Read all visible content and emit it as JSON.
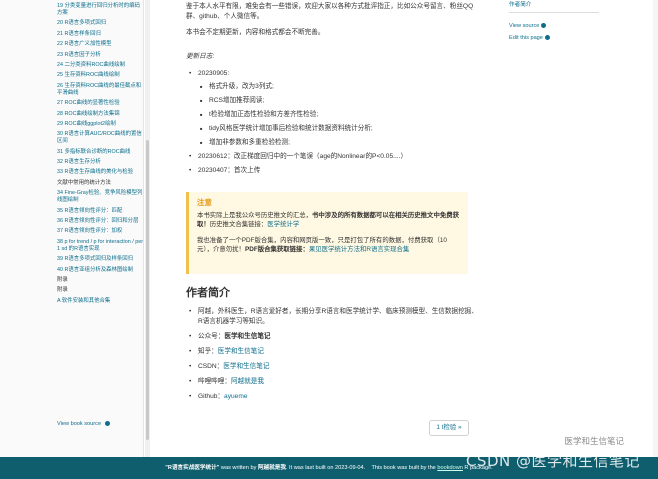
{
  "sidebar": {
    "items": [
      {
        "label": "19 分类变量进行回归分析时的编码方案",
        "kind": "link"
      },
      {
        "label": "20 R语言多项式回归",
        "kind": "link"
      },
      {
        "label": "21 R语言样条回归",
        "kind": "link"
      },
      {
        "label": "22 R语言广义加性模型",
        "kind": "link"
      },
      {
        "label": "23 R语言因子分析",
        "kind": "link"
      },
      {
        "label": "24 二分类资料ROC曲线绘制",
        "kind": "link"
      },
      {
        "label": "25 生存资料ROC曲线绘制",
        "kind": "link"
      },
      {
        "label": "26 生存资料ROC曲线的最佳截点和平滑曲线",
        "kind": "link"
      },
      {
        "label": "27 ROC曲线的显著性检验",
        "kind": "link"
      },
      {
        "label": "28 ROC曲线绘制方法集锦",
        "kind": "link"
      },
      {
        "label": "29 ROC曲线ggplot2绘制",
        "kind": "link"
      },
      {
        "label": "30 R语言计算AUC/ROC曲线的置信区间",
        "kind": "link"
      },
      {
        "label": "31 多指标联合诊断的ROC曲线",
        "kind": "link"
      },
      {
        "label": "32 R语言生存分析",
        "kind": "link"
      },
      {
        "label": "33 R语言生存曲线的美化与检验",
        "kind": "link"
      },
      {
        "label": "文献中常用的统计方法",
        "kind": "plain"
      },
      {
        "label": "34 Fine-Gray检验、竞争风险模型列线图绘制",
        "kind": "link"
      },
      {
        "label": "35 R语言倾向性评分：匹配",
        "kind": "link"
      },
      {
        "label": "36 R语言倾向性评分：回归和分层",
        "kind": "link"
      },
      {
        "label": "37 R语言倾向性评分：加权",
        "kind": "link"
      },
      {
        "label": "38 p for trend / p for interaction / per 1 sd 的R语言实现",
        "kind": "link"
      },
      {
        "label": "39 R语言多项式回归及样条回归",
        "kind": "link"
      },
      {
        "label": "40 R语言亚组分析及森林图绘制",
        "kind": "link"
      },
      {
        "label": "附录",
        "kind": "section"
      },
      {
        "label": "附录",
        "kind": "plain"
      },
      {
        "label": "A 软件安装和其他合集",
        "kind": "link"
      }
    ],
    "view_source": "View book source"
  },
  "main": {
    "intro_1": "鉴于本人水平有限，难免会有一些错误，欢迎大家以各种方式批评指正，比如公众号留言、粉丝QQ群、github、个人微信等。",
    "intro_2": "本书会不定期更新，内容和格式都会不断完善。",
    "update_heading": "更新日志:",
    "updates": [
      {
        "label": "20230905:",
        "sub": [
          "格式升级，改为3列式;",
          "RCS增加推荐阅读;",
          "t检验增加正态性检验和方差齐性检验;",
          "tidy风格医学统计增加事后检验和统计数据资料统计分析;",
          "增加非参数和多重检验检测;"
        ]
      },
      {
        "label": "20230612：改正梯度回归中的一个笔误（age的Nonlinear的P<0.05....）",
        "sub": []
      },
      {
        "label": "20230407：首次上传",
        "sub": []
      }
    ],
    "note": {
      "title": "注意",
      "text_1a": "本书实际上是我公众号历史推文的汇总，",
      "text_1b": "书中涉及的所有数据都可以在相关历史推文中免费获取！",
      "text_1c": "历史推文合集链接：",
      "link_1": "医学统计学",
      "text_2a": "我也准备了一个PDF版合集，内容和网页版一致，只是打包了所有的数据，付费获取（10元），介意勿扰！",
      "text_2b": "PDF版合集获取链接：",
      "link_2": "果见医学统计方法和R语言实现合集"
    },
    "about_heading": "作者简介",
    "about": [
      {
        "label": "阿越，外科医生，R语言爱好者，长期分享R语言和医学统计学、临床预测模型、生信数据挖掘、R语言机器学习等知识。",
        "value": ""
      },
      {
        "label": "公众号：",
        "value": "医学和生信笔记",
        "style": "bold"
      },
      {
        "label": "知乎：",
        "value": "医学和生信笔记",
        "style": "link"
      },
      {
        "label": "CSDN：",
        "value": "医学和生信笔记",
        "style": "link"
      },
      {
        "label": "哔哩哔哩：",
        "value": "阿越就是我",
        "style": "link"
      },
      {
        "label": "Github：",
        "value": "ayueme",
        "style": "link"
      }
    ],
    "next_button": "1 t检验 »"
  },
  "right": {
    "toc_title": "作者简介",
    "view_source": "View source",
    "edit_page": "Edit this page"
  },
  "footer": {
    "book_title": "\"R语言实战医学统计\"",
    "written_by": " was written by ",
    "author": "阿越就是我",
    "built_on": ". It was last built on 2023-09-04.",
    "built_with": "This book was built by the ",
    "bookdown": "bookdown",
    "r_package": " R package."
  },
  "watermark": {
    "text": "CSDN @医学和生信笔记",
    "sub": "医学和生信笔记"
  },
  "colors": {
    "link": "#0d6e8c",
    "footer": "#0f5e6e",
    "note_bg": "#fff8e2",
    "note_accent": "#f0c24c"
  }
}
